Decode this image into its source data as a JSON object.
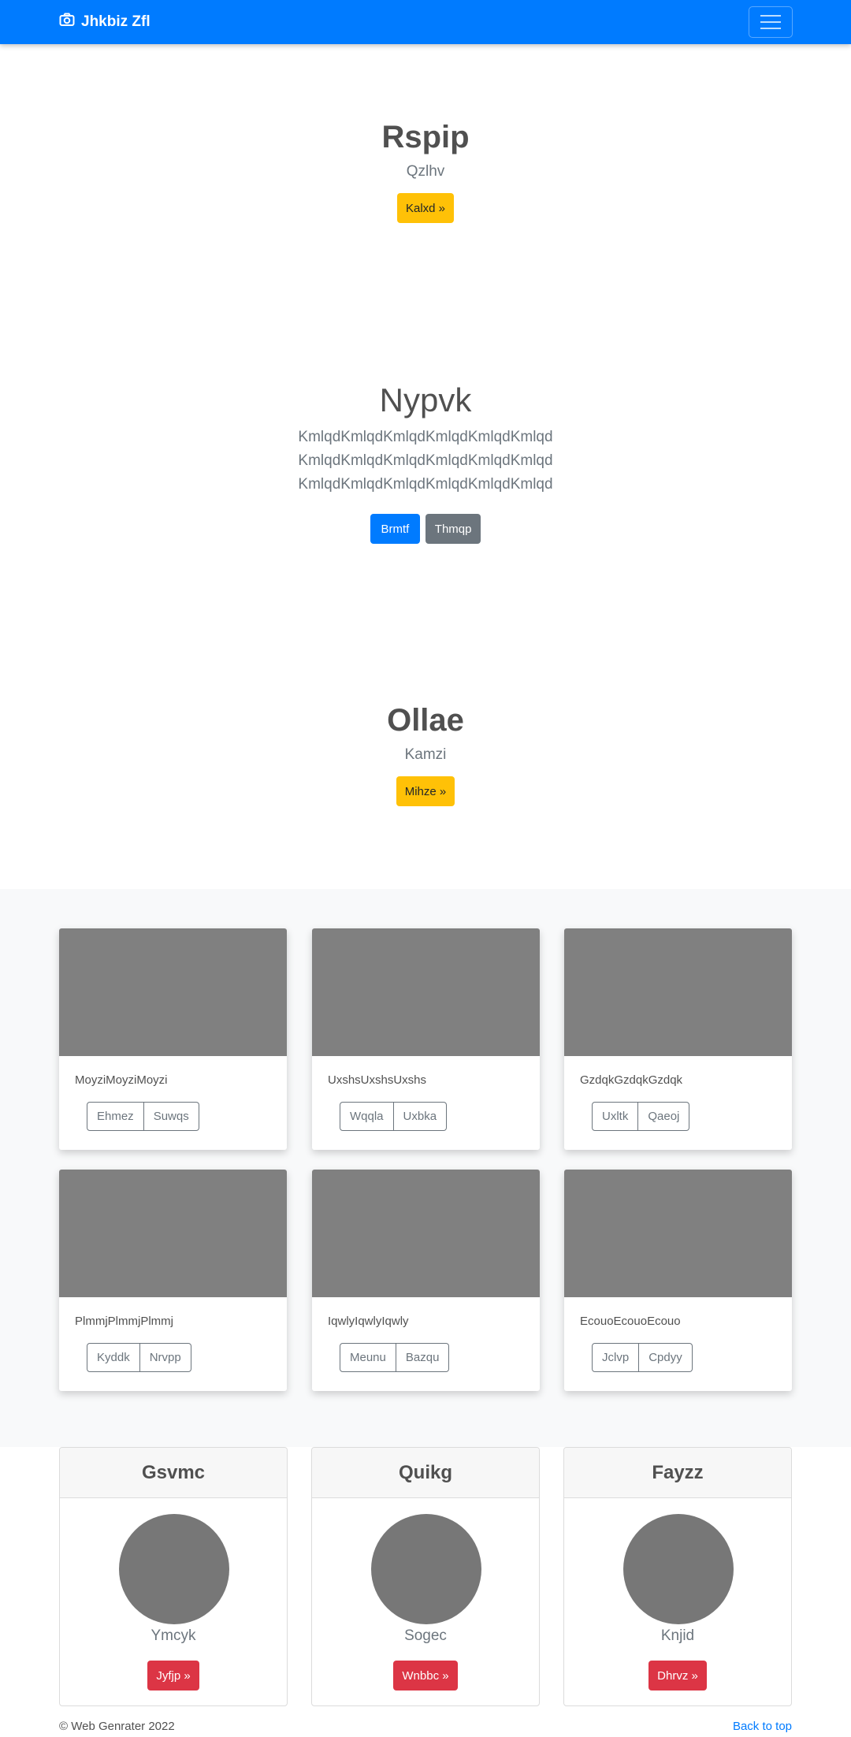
{
  "navbar": {
    "brand": "Jhkbiz Zfl",
    "brand_icon": "camera-icon",
    "toggle_icon": "hamburger-icon",
    "color": "#007bff"
  },
  "hero1": {
    "title": "Rspip",
    "subtitle": "Qzlhv",
    "button": "Kalxd »"
  },
  "hero2": {
    "title": "Nypvk",
    "lead_lines": [
      "KmlqdKmlqdKmlqdKmlqdKmlqdKmlqd",
      "KmlqdKmlqdKmlqdKmlqdKmlqdKmlqd",
      "KmlqdKmlqdKmlqdKmlqdKmlqdKmlqd"
    ],
    "primary_button": "Brmtf",
    "secondary_button": "Thmqp"
  },
  "hero3": {
    "title": "Ollae",
    "subtitle": "Kamzi",
    "button": "Mihze »"
  },
  "album": {
    "cards": [
      {
        "text": "MoyziMoyziMoyzi",
        "buttons": [
          "Ehmez",
          "Suwqs"
        ]
      },
      {
        "text": "UxshsUxshsUxshs",
        "buttons": [
          "Wqqla",
          "Uxbka"
        ]
      },
      {
        "text": "GzdqkGzdqkGzdqk",
        "buttons": [
          "Uxltk",
          "Qaeoj"
        ]
      },
      {
        "text": "PlmmjPlmmjPlmmj",
        "buttons": [
          "Kyddk",
          "Nrvpp"
        ]
      },
      {
        "text": "IqwlyIqwlyIqwly",
        "buttons": [
          "Meunu",
          "Bazqu"
        ]
      },
      {
        "text": "EcouoEcouoEcouo",
        "buttons": [
          "Jclvp",
          "Cpdyy"
        ]
      }
    ]
  },
  "profiles": [
    {
      "header": "Gsvmc",
      "name": "Ymcyk",
      "button": "Jyfjp »"
    },
    {
      "header": "Quikg",
      "name": "Sogec",
      "button": "Wnbbc »"
    },
    {
      "header": "Fayzz",
      "name": "Knjid",
      "button": "Dhrvz »"
    }
  ],
  "footer": {
    "copyright": "© Web Genrater 2022",
    "back_to_top": "Back to top"
  }
}
